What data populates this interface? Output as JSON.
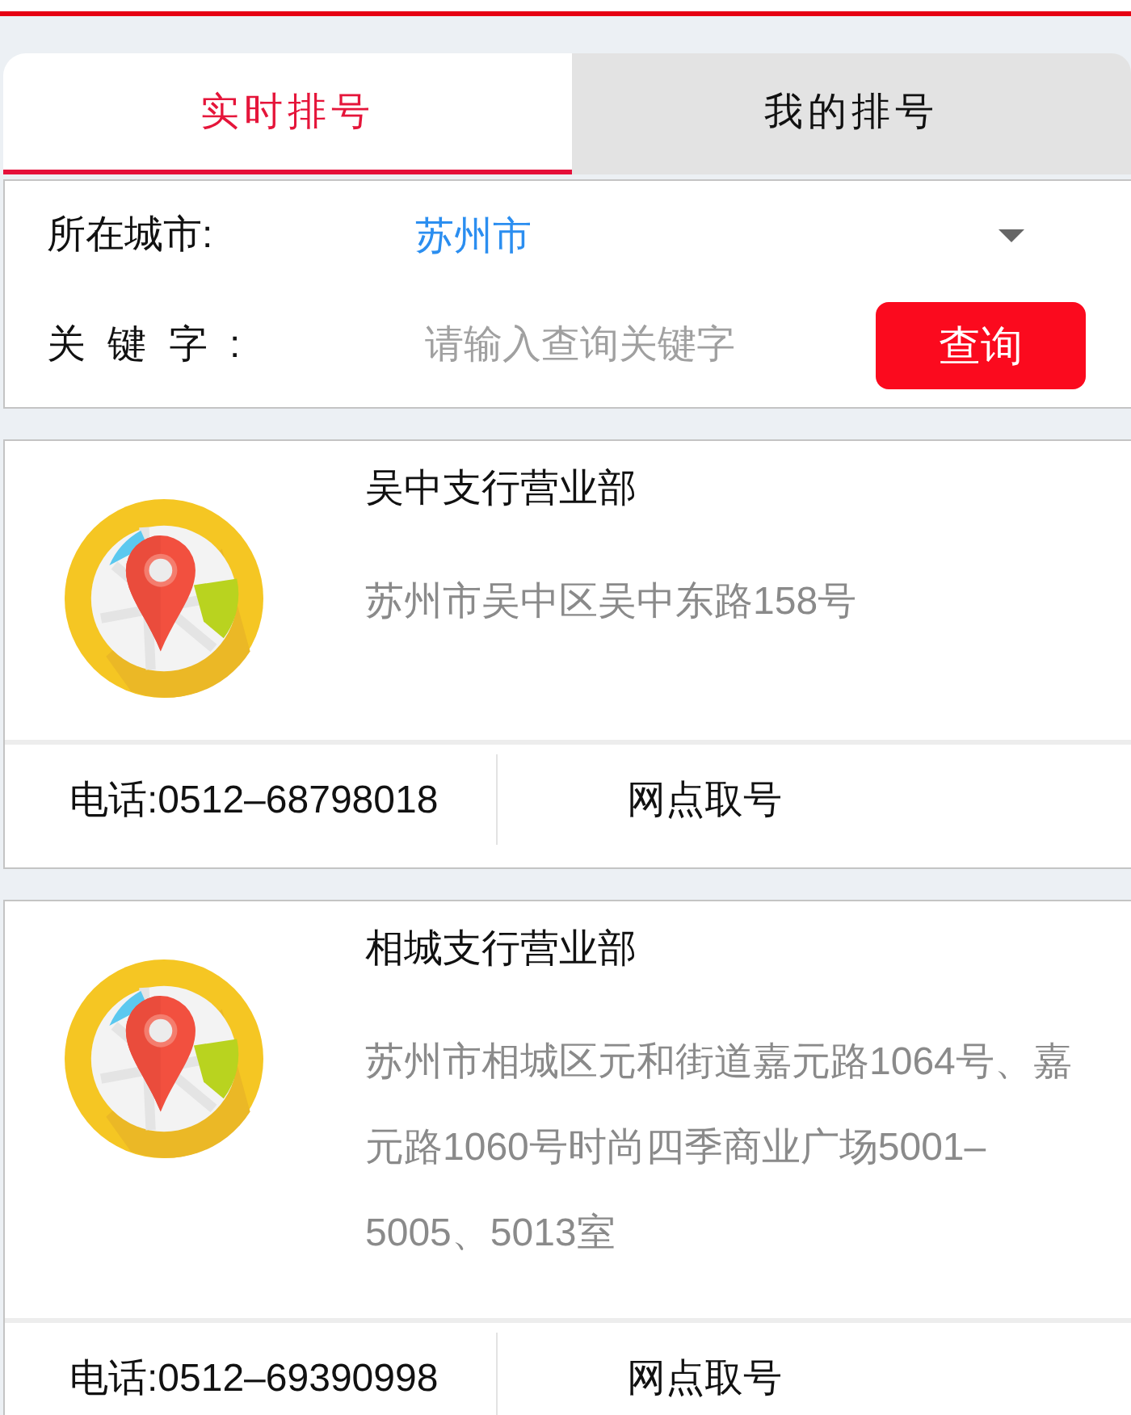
{
  "tabs": [
    {
      "label": "实时排号",
      "selected": true
    },
    {
      "label": "我的排号",
      "selected": false
    }
  ],
  "search_form": {
    "city": {
      "label": "所在城市:",
      "value": "苏州市"
    },
    "keyword": {
      "label": "关 键 字 :",
      "placeholder": "请输入查询关键字"
    },
    "query_button": "查询"
  },
  "branches": [
    {
      "name": "吴中支行营业部",
      "address": "苏州市吴中区吴中东路158号",
      "phone": "电话:0512–68798018",
      "action": "网点取号"
    },
    {
      "name": "相城支行营业部",
      "address": "苏州市相城区元和街道嘉元路1064号、嘉元路1060号时尚四季商业广场5001–5005、5013室",
      "phone": "电话:0512–69390998",
      "action": "网点取号"
    }
  ]
}
